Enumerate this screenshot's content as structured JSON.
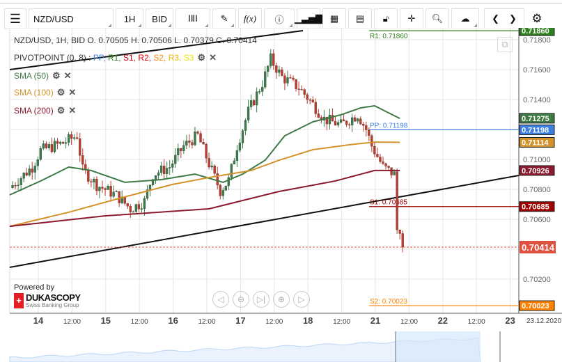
{
  "toolbar": {
    "symbol": "NZD/USD",
    "timeframe": "1H",
    "side": "BID",
    "indicator_label": "f(x)"
  },
  "legend": {
    "ohlc": "NZD/USD, 1H, BID   O. 0.70505 H. 0.70506 L. 0.70379 C. 0.70414",
    "pivot": "PIVOTPOINT (0, 8)",
    "pivot_items": [
      {
        "t": "PP",
        "c": "#3b7fe0"
      },
      {
        "t": "R1",
        "c": "#2e7d1e"
      },
      {
        "t": "S1",
        "c": "#c00000"
      },
      {
        "t": "R2",
        "c": "#e00000"
      },
      {
        "t": "S2",
        "c": "#ff8c00"
      },
      {
        "t": "R3",
        "c": "#f0b400"
      },
      {
        "t": "S3",
        "c": "#f0e000"
      }
    ],
    "sma50": "SMA (50)",
    "sma100": "SMA (100)",
    "sma200": "SMA (200)"
  },
  "branding": {
    "powered": "Powered by",
    "name": "DUKASCOPY",
    "tagline": "Swiss Banking Group"
  },
  "chart_data": {
    "type": "candlestick",
    "symbol": "NZD/USD",
    "timeframe": "1H",
    "ylim": [
      0.6995,
      0.719
    ],
    "y_ticks": [
      "0.71800",
      "0.71600",
      "0.71400",
      "0.71200",
      "0.71000",
      "0.70800",
      "0.70600",
      "0.70400",
      "0.70200"
    ],
    "x_ticks": [
      {
        "l": "14",
        "d": 0,
        "b": true
      },
      {
        "l": "12:00",
        "d": 0.5
      },
      {
        "l": "15",
        "d": 1,
        "b": true
      },
      {
        "l": "12:00",
        "d": 1.5
      },
      {
        "l": "16",
        "d": 2,
        "b": true
      },
      {
        "l": "12:00",
        "d": 2.5
      },
      {
        "l": "17",
        "d": 3,
        "b": true
      },
      {
        "l": "12:00",
        "d": 3.5
      },
      {
        "l": "18",
        "d": 4,
        "b": true
      },
      {
        "l": "12:00",
        "d": 4.5
      },
      {
        "l": "21",
        "d": 5,
        "b": true
      },
      {
        "l": "12:00",
        "d": 5.5
      },
      {
        "l": "22",
        "d": 6,
        "b": true
      },
      {
        "l": "12:00",
        "d": 6.5
      },
      {
        "l": "23",
        "d": 7,
        "b": true
      }
    ],
    "end_date": "23.12.2020",
    "price_waypoints": [
      [
        0,
        0.7081
      ],
      [
        8,
        0.7095
      ],
      [
        11,
        0.7106
      ],
      [
        19,
        0.7111
      ],
      [
        24,
        0.7116
      ],
      [
        26,
        0.7093
      ],
      [
        31,
        0.7083
      ],
      [
        38,
        0.7076
      ],
      [
        43,
        0.7067
      ],
      [
        48,
        0.7072
      ],
      [
        51,
        0.709
      ],
      [
        57,
        0.7095
      ],
      [
        62,
        0.7109
      ],
      [
        67,
        0.7116
      ],
      [
        71,
        0.7097
      ],
      [
        75,
        0.7079
      ],
      [
        78,
        0.7086
      ],
      [
        81,
        0.7109
      ],
      [
        85,
        0.7132
      ],
      [
        90,
        0.7151
      ],
      [
        93,
        0.7167
      ],
      [
        97,
        0.7155
      ],
      [
        103,
        0.7148
      ],
      [
        108,
        0.7137
      ],
      [
        112,
        0.7127
      ],
      [
        118,
        0.7123
      ],
      [
        124,
        0.713
      ],
      [
        127,
        0.712
      ],
      [
        129,
        0.7109
      ],
      [
        133,
        0.7095
      ],
      [
        137,
        0.709
      ],
      [
        138,
        0.7053
      ],
      [
        139,
        0.70505
      ],
      [
        140,
        0.70414
      ]
    ],
    "sma50": [
      [
        0,
        0.70763
      ],
      [
        11,
        0.70856
      ],
      [
        21,
        0.70949
      ],
      [
        29,
        0.70926
      ],
      [
        41,
        0.70847
      ],
      [
        54,
        0.70865
      ],
      [
        66,
        0.70902
      ],
      [
        76,
        0.70847
      ],
      [
        83,
        0.70902
      ],
      [
        91,
        0.70995
      ],
      [
        98,
        0.71158
      ],
      [
        108,
        0.71251
      ],
      [
        118,
        0.71298
      ],
      [
        125,
        0.71344
      ],
      [
        130,
        0.71358
      ],
      [
        139,
        0.71274
      ]
    ],
    "sma100": [
      [
        0,
        0.70553
      ],
      [
        21,
        0.70647
      ],
      [
        39,
        0.7074
      ],
      [
        58,
        0.70833
      ],
      [
        71,
        0.70879
      ],
      [
        86,
        0.70926
      ],
      [
        96,
        0.70995
      ],
      [
        108,
        0.71065
      ],
      [
        121,
        0.71098
      ],
      [
        130,
        0.71116
      ],
      [
        139,
        0.71114
      ]
    ],
    "sma200": [
      [
        0,
        0.70553
      ],
      [
        34,
        0.70623
      ],
      [
        71,
        0.7067
      ],
      [
        96,
        0.70786
      ],
      [
        116,
        0.70856
      ],
      [
        130,
        0.70926
      ],
      [
        139,
        0.70926
      ]
    ],
    "last_price": "0.70414",
    "sma_values": {
      "sma50": "0.71275",
      "sma100": "0.71114",
      "sma200": "0.70926"
    },
    "pivots": [
      {
        "name": "R1",
        "value": "0.71860",
        "label": "R1: 0.71860",
        "color": "#2e7d1e"
      },
      {
        "name": "PP",
        "value": "0.71198",
        "label": "PP: 0.71198",
        "color": "#3b7fe0"
      },
      {
        "name": "S1",
        "value": "0.70685",
        "label": "S1: 0.70685",
        "color": "#a00000"
      },
      {
        "name": "S2",
        "value": "0.70023",
        "label": "S2: 0.70023",
        "color": "#ff8000"
      }
    ],
    "colors": {
      "up": "#3a7d4a",
      "down": "#c0392b",
      "sma50": "#3d7a45",
      "sma100": "#d4922a",
      "sma200": "#8b1a2e",
      "last": "#e05040"
    }
  }
}
